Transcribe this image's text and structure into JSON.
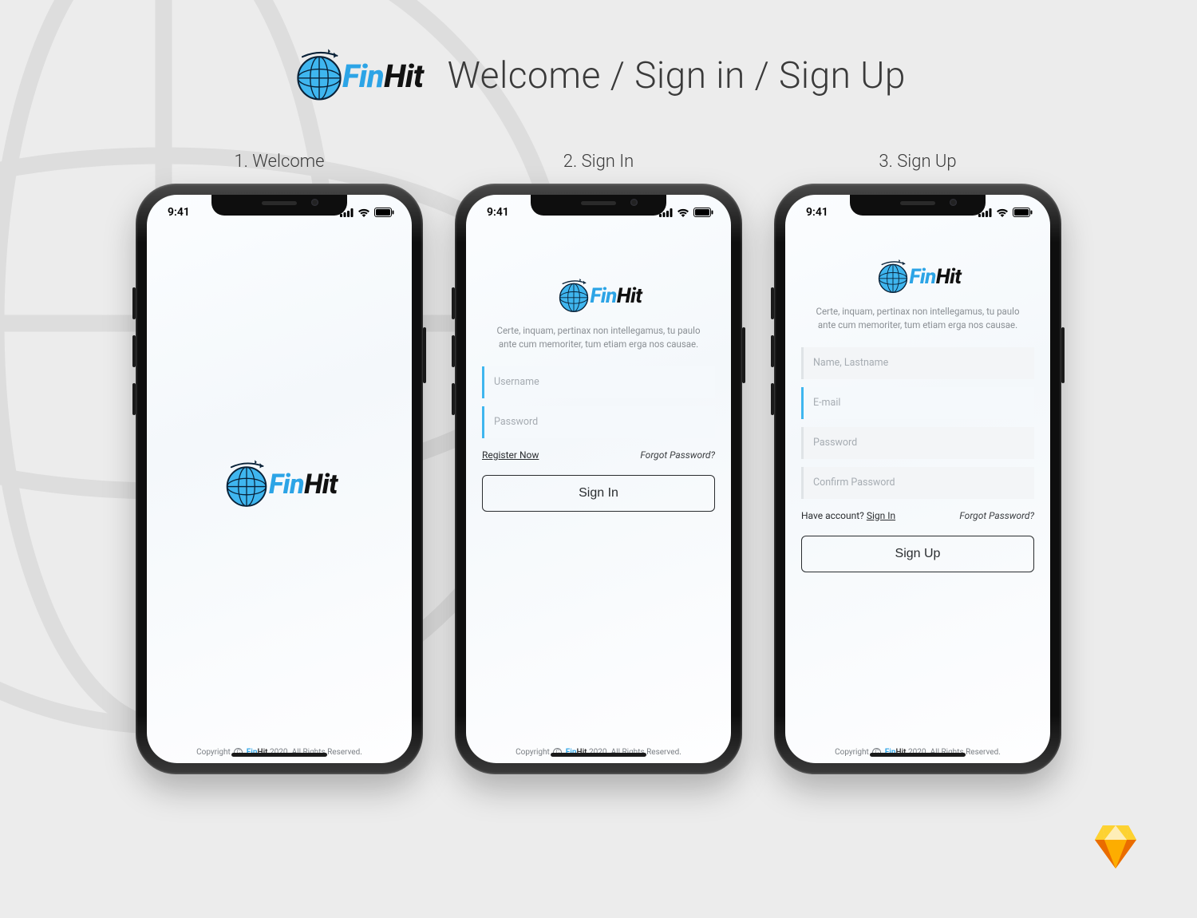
{
  "brand": {
    "part1": "Fin",
    "part2": "Hit"
  },
  "page_title": "Welcome / Sign in / Sign Up",
  "captions": {
    "c1": "1. Welcome",
    "c2": "2. Sign In",
    "c3": "3. Sign Up"
  },
  "status": {
    "time": "9:41"
  },
  "tagline": "Certe, inquam, pertinax non intellegamus, tu paulo ante cum memoriter, tum etiam erga nos causae.",
  "signin": {
    "fields": {
      "username": "Username",
      "password": "Password"
    },
    "register_link": "Register Now",
    "forgot_link": "Forgot Password?",
    "button": "Sign In"
  },
  "signup": {
    "fields": {
      "name": "Name, Lastname",
      "email": "E-mail",
      "password": "Password",
      "confirm": "Confirm Password"
    },
    "have_account_text": "Have account? ",
    "have_account_link": "Sign In",
    "forgot_link": "Forgot Password?",
    "button": "Sign Up"
  },
  "footer": {
    "prefix": "Copyright ",
    "c_mark": "C",
    "brand1": "Fin",
    "brand2": "Hit",
    "suffix": " 2020. All Rights Reserved."
  },
  "colors": {
    "accent": "#2ca4e6"
  }
}
